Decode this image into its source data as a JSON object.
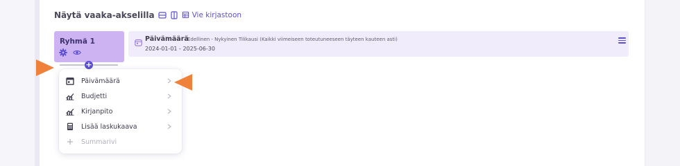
{
  "section": {
    "title": "Näytä vaaka-akselilla",
    "library_link": "Vie kirjastoon"
  },
  "group": {
    "name": "Ryhmä 1"
  },
  "date_filter": {
    "title": "Päivämäärä",
    "description": "Edellinen - Nykyinen Tilikausi (Kaikki viimeiseen toteutuneeseen täyteen kauteen asti)",
    "range": "2024-01-01 - 2025-06-30"
  },
  "add_button": {
    "symbol": "+"
  },
  "dropdown": {
    "items": [
      {
        "label": "Päivämäärä",
        "icon": "calendar-icon"
      },
      {
        "label": "Budjetti",
        "icon": "chart-icon"
      },
      {
        "label": "Kirjanpito",
        "icon": "chart-icon"
      },
      {
        "label": "Lisää laskukaava",
        "icon": "calculator-icon"
      },
      {
        "label": "Summarivi",
        "icon": "plus-icon"
      }
    ]
  },
  "colors": {
    "accent": "#5b4fd6",
    "group_card": "#cdb3f2",
    "date_row": "#f1ecfc",
    "annotation_arrow": "#f0813a"
  }
}
